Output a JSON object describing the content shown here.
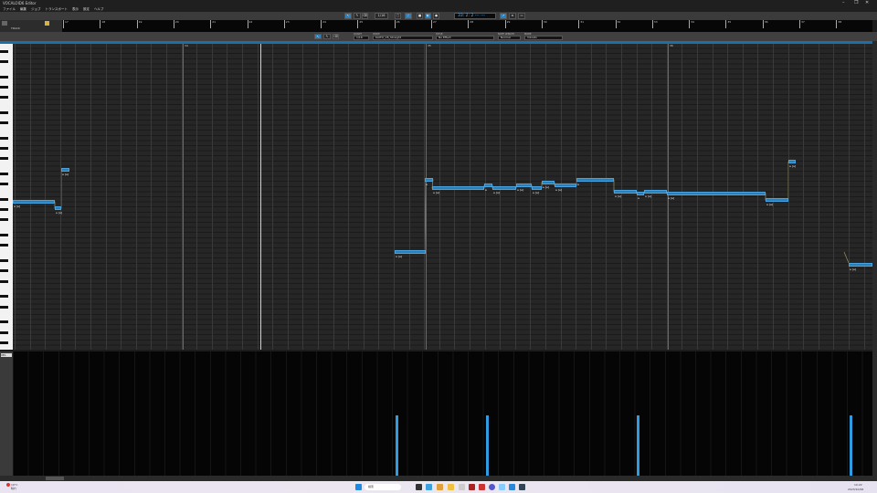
{
  "window": {
    "title": "VOCALOID6 Editor",
    "controls": [
      "–",
      "❐",
      "✕"
    ]
  },
  "menu": [
    "ファイル",
    "編集",
    "ジョブ",
    "トランスポート",
    "表示",
    "設定",
    "ヘルプ"
  ],
  "toolbar": {
    "quantize": "1/16",
    "timecode": "33: 2: 2  ---  ---",
    "buttons": [
      "select",
      "pencil",
      "eraser",
      "loop",
      "metronome",
      "stop",
      "play",
      "record"
    ]
  },
  "track": {
    "name": "TRACK"
  },
  "ruler": {
    "measures": [
      "17",
      "18",
      "19",
      "20",
      "21",
      "22",
      "23",
      "24",
      "25",
      "26",
      "27",
      "28",
      "29",
      "30",
      "31",
      "32",
      "33",
      "34",
      "35",
      "36",
      "37",
      "38"
    ]
  },
  "pianoroll": {
    "quantize_label": "QUANT",
    "quantize": "1/16",
    "voice_label": "VOICE",
    "voice": "KAITO_V6_Straight",
    "style_label": "STYLE",
    "style": "No Effect",
    "note_length_label": "NOTE LENGTH",
    "note_length": "Normal",
    "snap_label": "MODE",
    "snap": "Vibrato",
    "bars": [
      "34",
      "35",
      "36"
    ],
    "notes": [
      {
        "lyric": "a [a]"
      },
      {
        "lyric": "a [a]"
      },
      {
        "lyric": "a [a]"
      },
      {
        "lyric": "a [a]"
      },
      {
        "lyric": "a"
      },
      {
        "lyric": "a [a]"
      },
      {
        "lyric": "a"
      },
      {
        "lyric": "a [a]"
      },
      {
        "lyric": "a [a]"
      },
      {
        "lyric": "a [a]"
      },
      {
        "lyric": "a [a]"
      },
      {
        "lyric": "a [a]"
      },
      {
        "lyric": "a"
      },
      {
        "lyric": "a [a]"
      },
      {
        "lyric": "a"
      },
      {
        "lyric": "a [a]"
      },
      {
        "lyric": "a [a]"
      },
      {
        "lyric": "a [a]"
      },
      {
        "lyric": "a [a]"
      },
      {
        "lyric": "a [a]"
      },
      {
        "lyric": "a [a]"
      }
    ]
  },
  "parameter": {
    "name": "VEL",
    "values": [
      64,
      64,
      64,
      64
    ]
  },
  "taskbar": {
    "weather": "19°C",
    "weather_sub": "晴れ",
    "search": "検索",
    "time": "10:22",
    "date": "2023/10/06"
  }
}
